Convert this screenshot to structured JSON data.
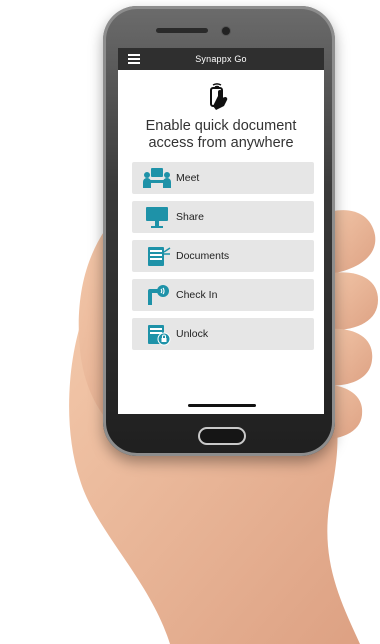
{
  "app": {
    "title": "Synappx Go"
  },
  "hero": {
    "headline": "Enable quick document access from anywhere",
    "icon": "tap-phone-icon"
  },
  "menu": {
    "items": [
      {
        "label": "Meet",
        "icon": "meeting-icon"
      },
      {
        "label": "Share",
        "icon": "display-share-icon"
      },
      {
        "label": "Documents",
        "icon": "scan-documents-icon"
      },
      {
        "label": "Check In",
        "icon": "nfc-checkin-icon"
      },
      {
        "label": "Unlock",
        "icon": "printer-unlock-icon"
      }
    ]
  },
  "colors": {
    "topbar": "#2f2f2f",
    "accent": "#1e92a8",
    "tile": "#e6e6e6"
  }
}
